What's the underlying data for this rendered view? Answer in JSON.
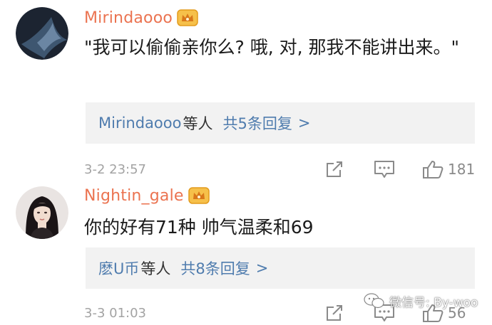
{
  "comments": [
    {
      "username": "Mirindaooo",
      "text": "\"我可以偷偷亲你么? 哦, 对, 那我不能讲出来。\"",
      "reply_users": "Mirindaooo",
      "reply_suffix": "等人",
      "reply_count": "共5条回复",
      "reply_arrow": ">",
      "timestamp": "3-2 23:57",
      "likes": "181",
      "icons": {
        "avatar": "dark-circle-avatar",
        "badge": "gold-crown-icon",
        "share": "share-edit-icon",
        "comment": "comment-icon",
        "like": "thumbs-up-icon"
      }
    },
    {
      "username": "Nightin_gale",
      "text": "你的好有71种 帅气温柔和69",
      "reply_users": "麽U币",
      "reply_suffix": "等人",
      "reply_count": "共8条回复",
      "reply_arrow": ">",
      "timestamp": "3-3 01:03",
      "likes": "56",
      "icons": {
        "avatar": "photo-avatar",
        "badge": "gold-crown-icon",
        "share": "share-edit-icon",
        "comment": "comment-icon",
        "like": "thumbs-up-icon"
      }
    }
  ],
  "watermark": {
    "text": "微信号: By-woo",
    "icon": "wechat-bubble-icon"
  },
  "colors": {
    "username": "#eb7350",
    "link": "#4f7cae",
    "reply_bg": "#f2f2f2",
    "meta": "#a3a3a3"
  }
}
